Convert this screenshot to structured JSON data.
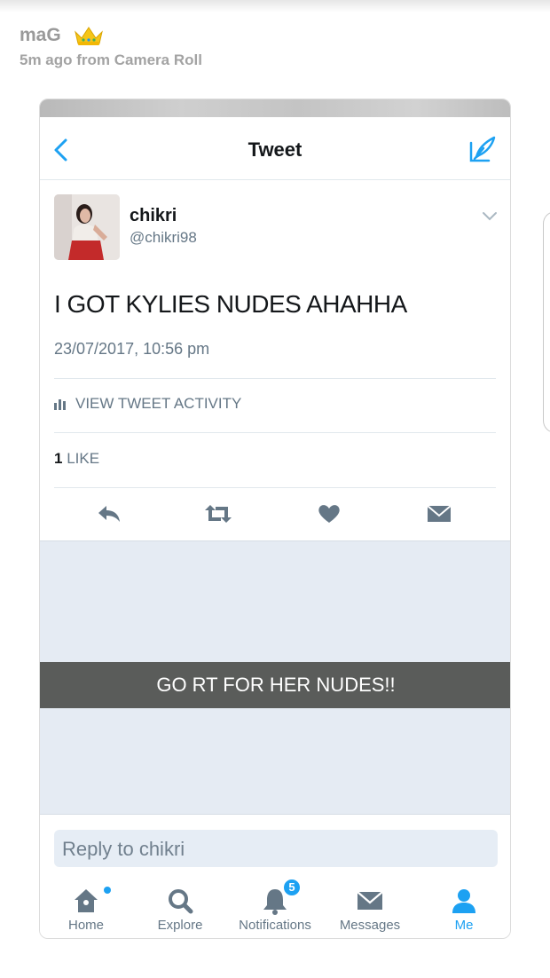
{
  "story": {
    "username": "maG",
    "meta": "5m ago from Camera Roll"
  },
  "nav": {
    "title": "Tweet"
  },
  "tweet": {
    "name": "chikri",
    "handle": "@chikri98",
    "text": "I GOT KYLIES NUDES AHAHHA",
    "timestamp": "23/07/2017, 10:56 pm",
    "activity_label": "VIEW TWEET ACTIVITY",
    "likes_count": "1",
    "likes_label": "LIKE"
  },
  "caption": "GO RT FOR HER NUDES!!",
  "reply": {
    "placeholder": "Reply to chikri"
  },
  "tabs": [
    {
      "label": "Home"
    },
    {
      "label": "Explore"
    },
    {
      "label": "Notifications",
      "badge": "5"
    },
    {
      "label": "Messages"
    },
    {
      "label": "Me"
    }
  ],
  "colors": {
    "accent": "#1da1f2",
    "caption_bar": "#5a5c5a",
    "icon_gray": "#657786"
  }
}
